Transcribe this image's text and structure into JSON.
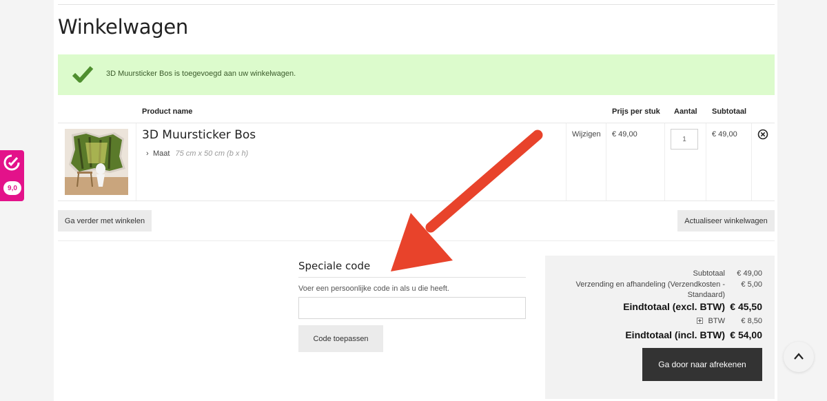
{
  "page": {
    "title": "Winkelwagen"
  },
  "notice": {
    "message": "3D Muursticker Bos is toegevoegd aan uw winkelwagen."
  },
  "table": {
    "headers": {
      "product": "Product name",
      "price": "Prijs per stuk",
      "qty": "Aantal",
      "subtotal": "Subtotaal"
    },
    "items": [
      {
        "name": "3D Muursticker Bos",
        "option_label": "Maat",
        "option_value": "75 cm x 50 cm (b x h)",
        "edit_label": "Wijzigen",
        "price": "€ 49,00",
        "qty": "1",
        "subtotal": "€ 49,00"
      }
    ]
  },
  "actions": {
    "continue_label": "Ga verder met winkelen",
    "update_label": "Actualiseer winkelwagen"
  },
  "coupon": {
    "title": "Speciale code",
    "description": "Voer een persoonlijke code in als u die heeft.",
    "placeholder": "",
    "apply_label": "Code toepassen"
  },
  "totals": {
    "subtotal_label": "Subtotaal",
    "subtotal_value": "€ 49,00",
    "shipping_label_1": "Verzending en afhandeling (Verzendkosten -",
    "shipping_label_2": "Standaard)",
    "shipping_value": "€ 5,00",
    "excl_label": "Eindtotaal (excl. BTW)",
    "excl_value": "€ 45,50",
    "tax_label": "BTW",
    "tax_value": "€ 8,50",
    "incl_label": "Eindtotaal (incl. BTW)",
    "incl_value": "€ 54,00",
    "checkout_label": "Ga door naar afrekenen"
  },
  "review_badge": {
    "score": "9,0"
  },
  "colors": {
    "success_bg": "#dcfbcc",
    "annotation_arrow": "#e8432b",
    "badge": "#e3128a",
    "checkout_bg": "#333333"
  },
  "icons": [
    "checkmark-icon",
    "chevron-right-icon",
    "remove-icon",
    "expand-plus-icon",
    "kiyoh-icon",
    "chevron-up-icon"
  ]
}
